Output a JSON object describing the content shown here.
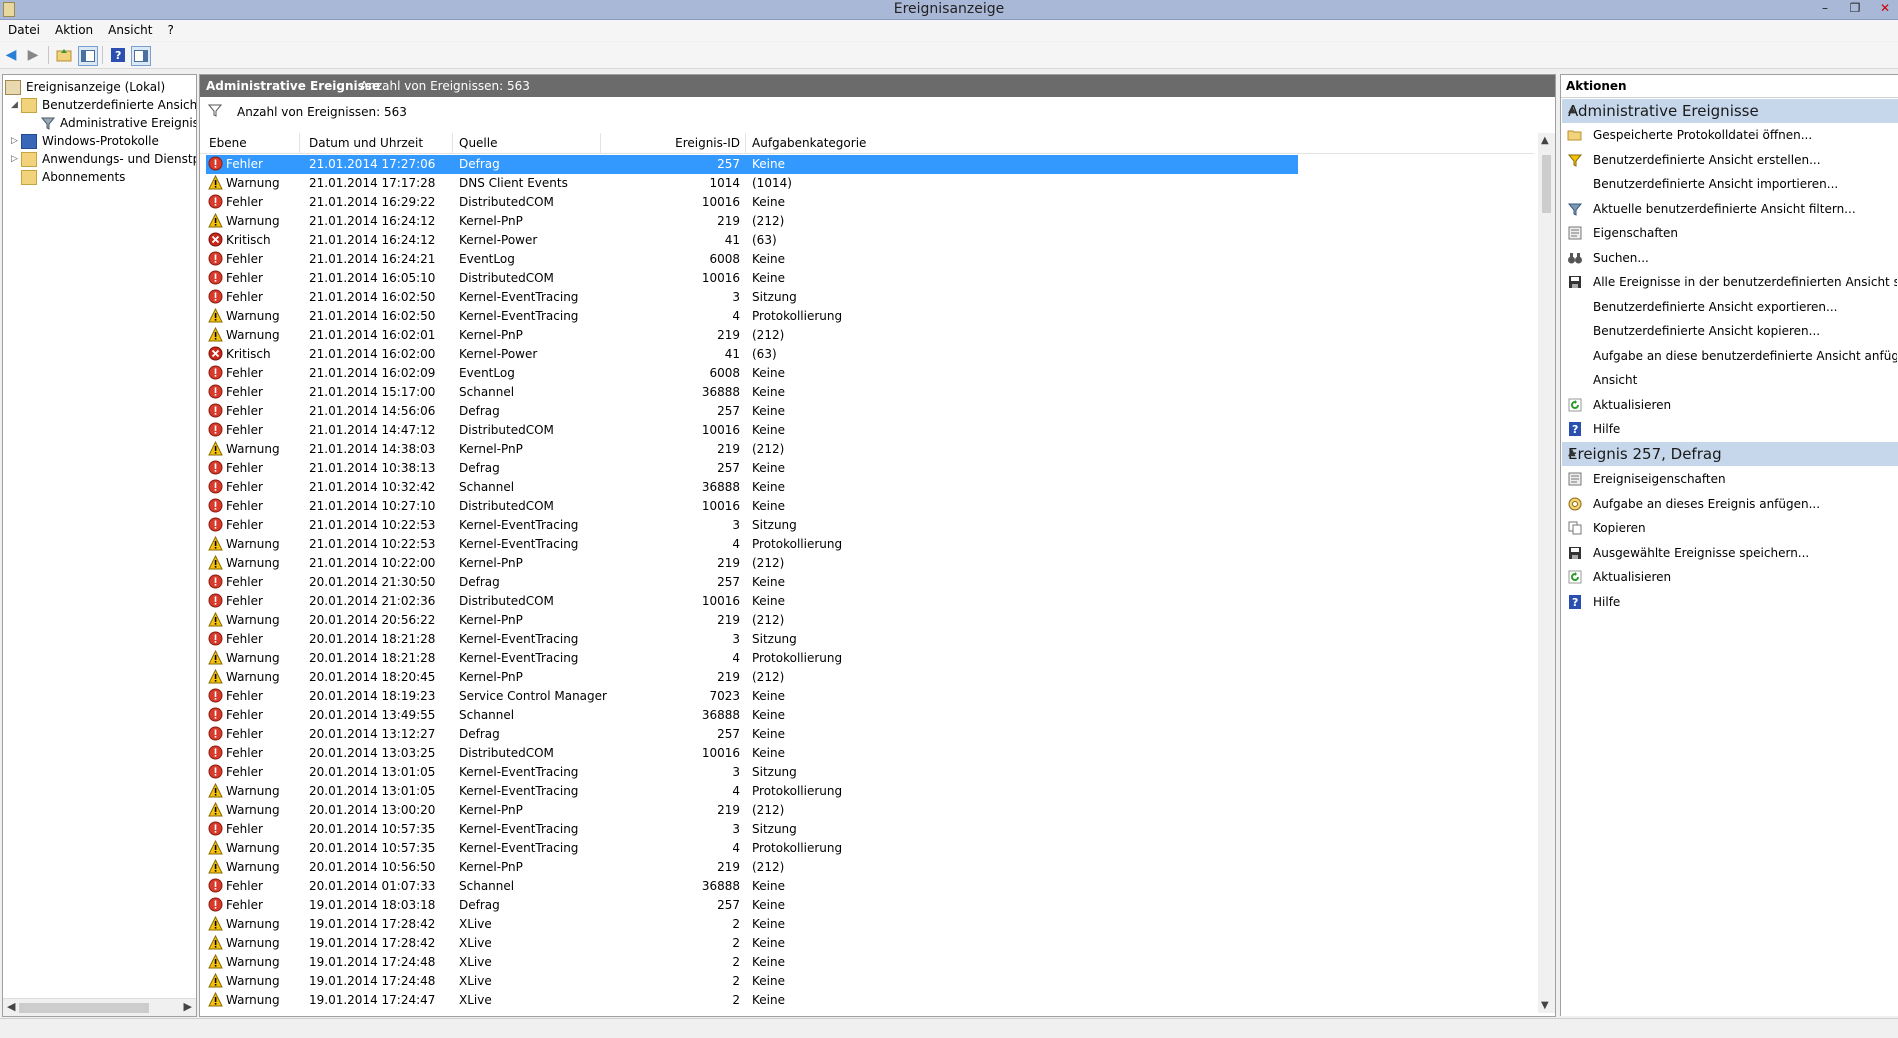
{
  "window": {
    "title": "Ereignisanzeige"
  },
  "menu": [
    "Datei",
    "Aktion",
    "Ansicht",
    "?"
  ],
  "tree": {
    "root": "Ereignisanzeige (Lokal)",
    "custom_views": "Benutzerdefinierte Ansichten",
    "admin_events": "Administrative Ereignisse",
    "windows_logs": "Windows-Protokolle",
    "app_logs": "Anwendungs- und Dienstprot",
    "subscriptions": "Abonnements"
  },
  "center": {
    "header_title": "Administrative Ereignisse",
    "header_count": "Anzahl von Ereignissen: 563",
    "filter_text": "Anzahl von Ereignissen: 563",
    "columns": [
      "Ebene",
      "Datum und Uhrzeit",
      "Quelle",
      "Ereignis-ID",
      "Aufgabenkategorie"
    ],
    "rows": [
      [
        "Fehler",
        "21.01.2014 17:27:06",
        "Defrag",
        "257",
        "Keine"
      ],
      [
        "Warnung",
        "21.01.2014 17:17:28",
        "DNS Client Events",
        "1014",
        "(1014)"
      ],
      [
        "Fehler",
        "21.01.2014 16:29:22",
        "DistributedCOM",
        "10016",
        "Keine"
      ],
      [
        "Warnung",
        "21.01.2014 16:24:12",
        "Kernel-PnP",
        "219",
        "(212)"
      ],
      [
        "Kritisch",
        "21.01.2014 16:24:12",
        "Kernel-Power",
        "41",
        "(63)"
      ],
      [
        "Fehler",
        "21.01.2014 16:24:21",
        "EventLog",
        "6008",
        "Keine"
      ],
      [
        "Fehler",
        "21.01.2014 16:05:10",
        "DistributedCOM",
        "10016",
        "Keine"
      ],
      [
        "Fehler",
        "21.01.2014 16:02:50",
        "Kernel-EventTracing",
        "3",
        "Sitzung"
      ],
      [
        "Warnung",
        "21.01.2014 16:02:50",
        "Kernel-EventTracing",
        "4",
        "Protokollierung"
      ],
      [
        "Warnung",
        "21.01.2014 16:02:01",
        "Kernel-PnP",
        "219",
        "(212)"
      ],
      [
        "Kritisch",
        "21.01.2014 16:02:00",
        "Kernel-Power",
        "41",
        "(63)"
      ],
      [
        "Fehler",
        "21.01.2014 16:02:09",
        "EventLog",
        "6008",
        "Keine"
      ],
      [
        "Fehler",
        "21.01.2014 15:17:00",
        "Schannel",
        "36888",
        "Keine"
      ],
      [
        "Fehler",
        "21.01.2014 14:56:06",
        "Defrag",
        "257",
        "Keine"
      ],
      [
        "Fehler",
        "21.01.2014 14:47:12",
        "DistributedCOM",
        "10016",
        "Keine"
      ],
      [
        "Warnung",
        "21.01.2014 14:38:03",
        "Kernel-PnP",
        "219",
        "(212)"
      ],
      [
        "Fehler",
        "21.01.2014 10:38:13",
        "Defrag",
        "257",
        "Keine"
      ],
      [
        "Fehler",
        "21.01.2014 10:32:42",
        "Schannel",
        "36888",
        "Keine"
      ],
      [
        "Fehler",
        "21.01.2014 10:27:10",
        "DistributedCOM",
        "10016",
        "Keine"
      ],
      [
        "Fehler",
        "21.01.2014 10:22:53",
        "Kernel-EventTracing",
        "3",
        "Sitzung"
      ],
      [
        "Warnung",
        "21.01.2014 10:22:53",
        "Kernel-EventTracing",
        "4",
        "Protokollierung"
      ],
      [
        "Warnung",
        "21.01.2014 10:22:00",
        "Kernel-PnP",
        "219",
        "(212)"
      ],
      [
        "Fehler",
        "20.01.2014 21:30:50",
        "Defrag",
        "257",
        "Keine"
      ],
      [
        "Fehler",
        "20.01.2014 21:02:36",
        "DistributedCOM",
        "10016",
        "Keine"
      ],
      [
        "Warnung",
        "20.01.2014 20:56:22",
        "Kernel-PnP",
        "219",
        "(212)"
      ],
      [
        "Fehler",
        "20.01.2014 18:21:28",
        "Kernel-EventTracing",
        "3",
        "Sitzung"
      ],
      [
        "Warnung",
        "20.01.2014 18:21:28",
        "Kernel-EventTracing",
        "4",
        "Protokollierung"
      ],
      [
        "Warnung",
        "20.01.2014 18:20:45",
        "Kernel-PnP",
        "219",
        "(212)"
      ],
      [
        "Fehler",
        "20.01.2014 18:19:23",
        "Service Control Manager",
        "7023",
        "Keine"
      ],
      [
        "Fehler",
        "20.01.2014 13:49:55",
        "Schannel",
        "36888",
        "Keine"
      ],
      [
        "Fehler",
        "20.01.2014 13:12:27",
        "Defrag",
        "257",
        "Keine"
      ],
      [
        "Fehler",
        "20.01.2014 13:03:25",
        "DistributedCOM",
        "10016",
        "Keine"
      ],
      [
        "Fehler",
        "20.01.2014 13:01:05",
        "Kernel-EventTracing",
        "3",
        "Sitzung"
      ],
      [
        "Warnung",
        "20.01.2014 13:01:05",
        "Kernel-EventTracing",
        "4",
        "Protokollierung"
      ],
      [
        "Warnung",
        "20.01.2014 13:00:20",
        "Kernel-PnP",
        "219",
        "(212)"
      ],
      [
        "Fehler",
        "20.01.2014 10:57:35",
        "Kernel-EventTracing",
        "3",
        "Sitzung"
      ],
      [
        "Warnung",
        "20.01.2014 10:57:35",
        "Kernel-EventTracing",
        "4",
        "Protokollierung"
      ],
      [
        "Warnung",
        "20.01.2014 10:56:50",
        "Kernel-PnP",
        "219",
        "(212)"
      ],
      [
        "Fehler",
        "20.01.2014 01:07:33",
        "Schannel",
        "36888",
        "Keine"
      ],
      [
        "Fehler",
        "19.01.2014 18:03:18",
        "Defrag",
        "257",
        "Keine"
      ],
      [
        "Warnung",
        "19.01.2014 17:28:42",
        "XLive",
        "2",
        "Keine"
      ],
      [
        "Warnung",
        "19.01.2014 17:28:42",
        "XLive",
        "2",
        "Keine"
      ],
      [
        "Warnung",
        "19.01.2014 17:24:48",
        "XLive",
        "2",
        "Keine"
      ],
      [
        "Warnung",
        "19.01.2014 17:24:48",
        "XLive",
        "2",
        "Keine"
      ],
      [
        "Warnung",
        "19.01.2014 17:24:47",
        "XLive",
        "2",
        "Keine"
      ]
    ]
  },
  "actions": {
    "title": "Aktionen",
    "section1": {
      "title": "Administrative Ereignisse",
      "items": [
        {
          "label": "Gespeicherte Protokolldatei öffnen...",
          "icon": "folder-open-icon"
        },
        {
          "label": "Benutzerdefinierte Ansicht erstellen...",
          "icon": "filter-create-icon"
        },
        {
          "label": "Benutzerdefinierte Ansicht importieren...",
          "icon": ""
        },
        {
          "label": "Aktuelle benutzerdefinierte Ansicht filtern...",
          "icon": "filter-icon"
        },
        {
          "label": "Eigenschaften",
          "icon": "properties-icon"
        },
        {
          "label": "Suchen...",
          "icon": "binoculars-icon"
        },
        {
          "label": "Alle Ereignisse in der benutzerdefinierten Ansicht speic...",
          "icon": "save-icon"
        },
        {
          "label": "Benutzerdefinierte Ansicht exportieren...",
          "icon": ""
        },
        {
          "label": "Benutzerdefinierte Ansicht kopieren...",
          "icon": ""
        },
        {
          "label": "Aufgabe an diese benutzerdefinierte Ansicht anfügen...",
          "icon": ""
        },
        {
          "label": "Ansicht",
          "icon": ""
        },
        {
          "label": "Aktualisieren",
          "icon": "refresh-icon"
        },
        {
          "label": "Hilfe",
          "icon": "help-icon"
        }
      ]
    },
    "section2": {
      "title": "Ereignis 257, Defrag",
      "items": [
        {
          "label": "Ereigniseigenschaften",
          "icon": "properties-icon"
        },
        {
          "label": "Aufgabe an dieses Ereignis anfügen...",
          "icon": "task-icon"
        },
        {
          "label": "Kopieren",
          "icon": "copy-icon"
        },
        {
          "label": "Ausgewählte Ereignisse speichern...",
          "icon": "save-icon"
        },
        {
          "label": "Aktualisieren",
          "icon": "refresh-icon"
        },
        {
          "label": "Hilfe",
          "icon": "help-icon"
        }
      ]
    }
  },
  "colors": {
    "selection": "#3399ff",
    "section_bg": "#c6d7ec",
    "error": "#d83b2b",
    "warning": "#f4c20d"
  }
}
